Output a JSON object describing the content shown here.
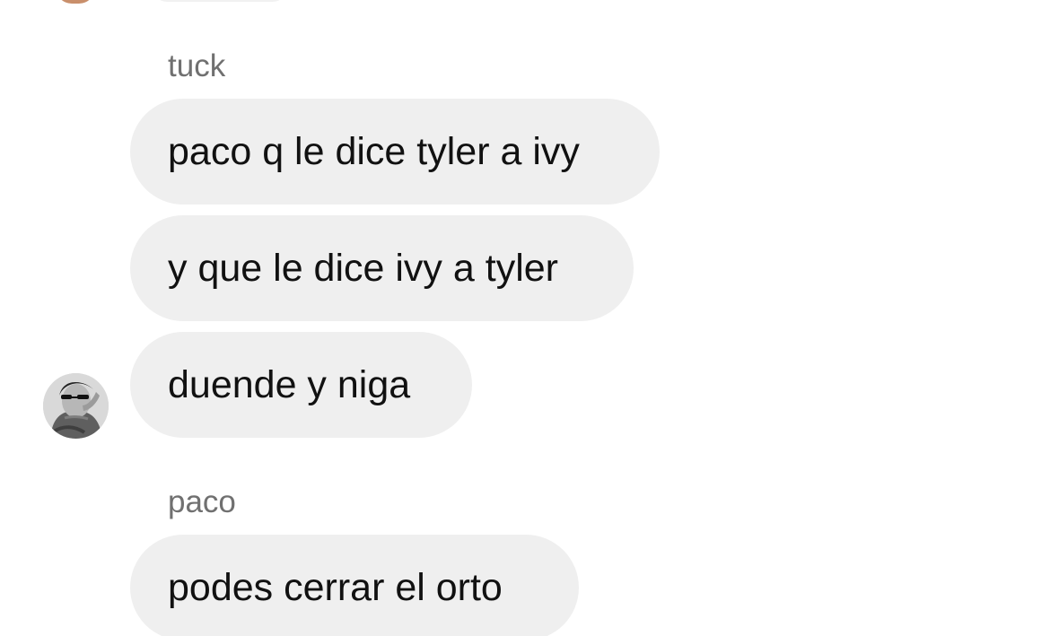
{
  "chat": {
    "messages": [
      {
        "sender": "tuck",
        "text": "paco q le dice tyler a ivy"
      },
      {
        "sender": "tuck",
        "text": "y que le dice ivy a tyler"
      },
      {
        "sender": "tuck",
        "text": "duende y niga"
      },
      {
        "sender": "paco",
        "text": "podes cerrar el orto"
      }
    ]
  },
  "colors": {
    "background": "#ffffff",
    "bubble": "#efefef",
    "sender_name": "#707070",
    "text": "#111111"
  },
  "icons": {
    "avatar": "profile-photo"
  }
}
